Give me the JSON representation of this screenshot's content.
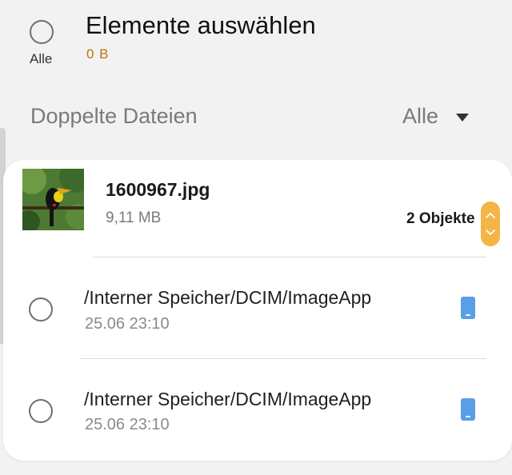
{
  "header": {
    "select_all_label": "Alle",
    "title": "Elemente auswählen",
    "selected_size": "0 B"
  },
  "section": {
    "title": "Doppelte Dateien",
    "filter_value": "Alle"
  },
  "group": {
    "file_name": "1600967.jpg",
    "file_size": "9,11 MB",
    "object_count": "2 Objekte",
    "items": [
      {
        "path": "/Interner Speicher/DCIM/ImageApp",
        "timestamp": "25.06 23:10",
        "icon": "phone-storage-icon"
      },
      {
        "path": "/Interner Speicher/DCIM/ImageApp",
        "timestamp": "25.06 23:10",
        "icon": "phone-storage-icon"
      }
    ]
  },
  "colors": {
    "accent": "#f3b545",
    "size_text": "#b87608",
    "device_icon": "#5a9ee8"
  }
}
